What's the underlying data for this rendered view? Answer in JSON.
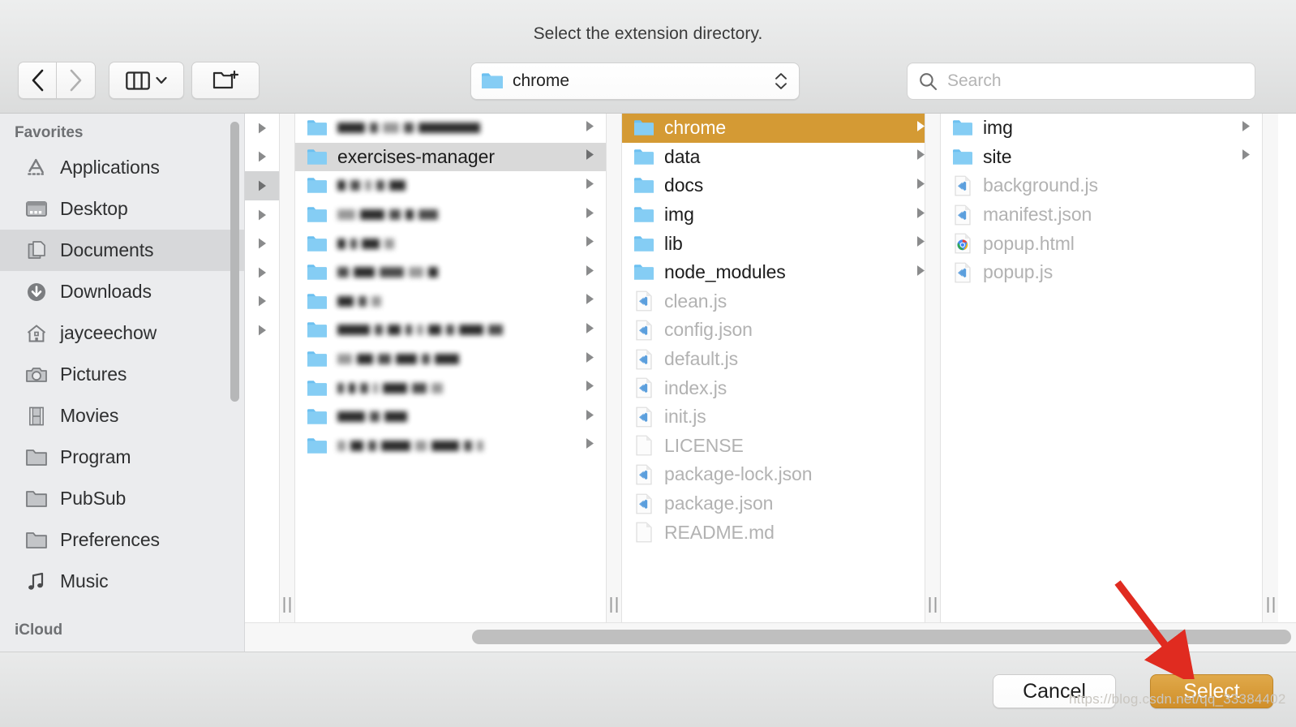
{
  "dialog": {
    "title": "Select the extension directory."
  },
  "toolbar": {
    "back_label": "Back",
    "forward_label": "Forward",
    "view_label": "Column view",
    "new_folder_label": "New Folder",
    "path_value": "chrome",
    "search_placeholder": "Search"
  },
  "sidebar": {
    "sections": [
      {
        "header": "Favorites",
        "items": [
          {
            "label": "Applications",
            "icon": "applications-icon",
            "selected": false
          },
          {
            "label": "Desktop",
            "icon": "desktop-icon",
            "selected": false
          },
          {
            "label": "Documents",
            "icon": "documents-icon",
            "selected": true
          },
          {
            "label": "Downloads",
            "icon": "downloads-icon",
            "selected": false
          },
          {
            "label": "jayceechow",
            "icon": "home-icon",
            "selected": false
          },
          {
            "label": "Pictures",
            "icon": "pictures-icon",
            "selected": false
          },
          {
            "label": "Movies",
            "icon": "movies-icon",
            "selected": false
          },
          {
            "label": "Program",
            "icon": "folder-icon",
            "selected": false
          },
          {
            "label": "PubSub",
            "icon": "folder-icon",
            "selected": false
          },
          {
            "label": "Preferences",
            "icon": "folder-icon",
            "selected": false
          },
          {
            "label": "Music",
            "icon": "music-icon",
            "selected": false
          }
        ]
      },
      {
        "header": "iCloud",
        "items": []
      }
    ]
  },
  "columns": [
    {
      "name": "previous-column-partial",
      "rows": [
        {
          "redacted": true,
          "selected": false
        },
        {
          "redacted": true,
          "selected": false
        },
        {
          "redacted": true,
          "selected": true
        },
        {
          "redacted": true,
          "selected": false
        },
        {
          "redacted": true,
          "selected": false
        },
        {
          "redacted": true,
          "selected": false
        },
        {
          "redacted": true,
          "selected": false
        },
        {
          "redacted": true,
          "selected": false
        }
      ]
    },
    {
      "name": "column-parent",
      "rows": [
        {
          "label": "",
          "redacted": true,
          "mask": [
            34,
            10,
            20,
            10,
            10,
            14,
            76
          ],
          "kind": "folder",
          "selected": false,
          "expandable": true
        },
        {
          "label": "exercises-manager",
          "redacted": false,
          "kind": "folder",
          "selected": true,
          "expandable": true
        },
        {
          "label": "",
          "redacted": true,
          "mask": [
            10,
            12,
            8,
            6,
            10,
            18
          ],
          "kind": "folder",
          "selected": false,
          "expandable": true
        },
        {
          "label": "",
          "redacted": true,
          "mask": [
            22,
            10,
            30,
            14,
            10,
            24
          ],
          "kind": "folder",
          "selected": false,
          "expandable": true
        },
        {
          "label": "",
          "redacted": true,
          "mask": [
            10,
            8,
            22,
            12
          ],
          "kind": "folder",
          "selected": false,
          "expandable": true
        },
        {
          "label": "",
          "redacted": true,
          "mask": [
            14,
            26,
            30,
            10,
            18,
            12
          ],
          "kind": "folder",
          "selected": false,
          "expandable": true
        },
        {
          "label": "",
          "redacted": true,
          "mask": [
            20,
            10,
            12
          ],
          "kind": "folder",
          "selected": false,
          "expandable": true
        },
        {
          "label": "",
          "redacted": true,
          "mask": [
            40,
            10,
            16,
            8,
            8,
            16,
            10,
            30,
            26,
            18
          ],
          "kind": "folder",
          "selected": false,
          "expandable": true
        },
        {
          "label": "",
          "redacted": true,
          "mask": [
            18,
            20,
            16,
            10,
            26,
            30
          ],
          "kind": "folder",
          "selected": false,
          "expandable": true
        },
        {
          "label": "",
          "redacted": true,
          "mask": [
            8,
            8,
            10,
            6,
            10,
            30,
            18,
            14,
            8
          ],
          "kind": "folder",
          "selected": false,
          "expandable": true
        },
        {
          "label": "",
          "redacted": true,
          "mask": [
            34,
            10,
            28
          ],
          "kind": "folder",
          "selected": false,
          "expandable": true
        },
        {
          "label": "",
          "redacted": true,
          "mask": [
            10,
            16,
            10,
            36,
            14,
            34,
            10,
            8,
            10
          ],
          "kind": "folder",
          "selected": false,
          "expandable": true
        }
      ]
    },
    {
      "name": "column-exercises-manager",
      "rows": [
        {
          "label": "chrome",
          "kind": "folder",
          "selected": true,
          "expandable": true
        },
        {
          "label": "data",
          "kind": "folder",
          "selected": false,
          "expandable": true
        },
        {
          "label": "docs",
          "kind": "folder",
          "selected": false,
          "expandable": true
        },
        {
          "label": "img",
          "kind": "folder",
          "selected": false,
          "expandable": true
        },
        {
          "label": "lib",
          "kind": "folder",
          "selected": false,
          "expandable": true
        },
        {
          "label": "node_modules",
          "kind": "folder",
          "selected": false,
          "expandable": true
        },
        {
          "label": "clean.js",
          "kind": "code-file",
          "selected": false,
          "expandable": false,
          "disabled": true
        },
        {
          "label": "config.json",
          "kind": "code-file",
          "selected": false,
          "expandable": false,
          "disabled": true
        },
        {
          "label": "default.js",
          "kind": "code-file",
          "selected": false,
          "expandable": false,
          "disabled": true
        },
        {
          "label": "index.js",
          "kind": "code-file",
          "selected": false,
          "expandable": false,
          "disabled": true
        },
        {
          "label": "init.js",
          "kind": "code-file",
          "selected": false,
          "expandable": false,
          "disabled": true
        },
        {
          "label": "LICENSE",
          "kind": "plain-file",
          "selected": false,
          "expandable": false,
          "disabled": true
        },
        {
          "label": "package-lock.json",
          "kind": "code-file",
          "selected": false,
          "expandable": false,
          "disabled": true
        },
        {
          "label": "package.json",
          "kind": "code-file",
          "selected": false,
          "expandable": false,
          "disabled": true
        },
        {
          "label": "README.md",
          "kind": "plain-file",
          "selected": false,
          "expandable": false,
          "disabled": true
        }
      ]
    },
    {
      "name": "column-chrome",
      "rows": [
        {
          "label": "img",
          "kind": "folder",
          "selected": false,
          "expandable": true
        },
        {
          "label": "site",
          "kind": "folder",
          "selected": false,
          "expandable": true
        },
        {
          "label": "background.js",
          "kind": "code-file",
          "selected": false,
          "expandable": false,
          "disabled": true
        },
        {
          "label": "manifest.json",
          "kind": "code-file",
          "selected": false,
          "expandable": false,
          "disabled": true
        },
        {
          "label": "popup.html",
          "kind": "chrome-file",
          "selected": false,
          "expandable": false,
          "disabled": true
        },
        {
          "label": "popup.js",
          "kind": "code-file",
          "selected": false,
          "expandable": false,
          "disabled": true
        }
      ]
    }
  ],
  "footer": {
    "cancel_label": "Cancel",
    "select_label": "Select"
  },
  "annotation": {
    "watermark": "https://blog.csdn.net/qq_33384402",
    "arrow_color": "#e02b20"
  },
  "colors": {
    "selection_orange": "#d49a34",
    "selection_gray": "#d9d9d9",
    "folder_blue": "#6cc0f0",
    "sidebar_bg": "#ebecee"
  }
}
